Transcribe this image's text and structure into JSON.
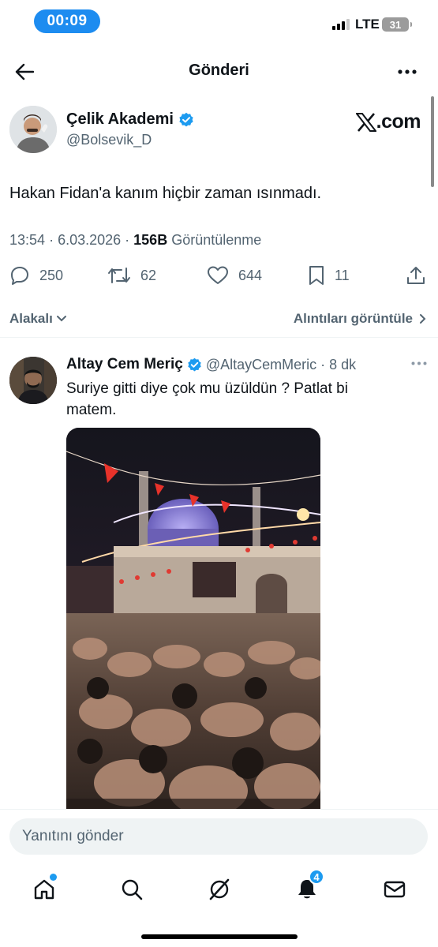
{
  "status_bar": {
    "time": "00:09",
    "network": "LTE",
    "battery": "31"
  },
  "header": {
    "title": "Gönderi"
  },
  "tweet": {
    "author_name": "Çelik Akademi",
    "author_handle": "@Bolsevik_D",
    "source_logo": ".com",
    "text": "Hakan Fidan'a kanım hiçbir zaman ısınmadı.",
    "time": "13:54",
    "date": "6.03.2026",
    "views_count": "156B",
    "views_label": "Görüntülenme",
    "replies": "250",
    "retweets": "62",
    "likes": "644",
    "bookmarks": "11"
  },
  "sort": {
    "left_label": "Alakalı",
    "right_label": "Alıntıları görüntüle"
  },
  "reply": {
    "author_name": "Altay Cem Meriç",
    "author_handle": "@AltayCemMeric",
    "time_ago": "8 dk",
    "text": "Suriye gitti diye çok mu üzüldün ? Patlat bi matem."
  },
  "composer": {
    "placeholder": "Yanıtını gönder"
  },
  "tabbar": {
    "notification_count": "4"
  },
  "colors": {
    "accent": "#1d9bf0",
    "time_pill": "#1d8cf0",
    "secondary_text": "#536471"
  }
}
